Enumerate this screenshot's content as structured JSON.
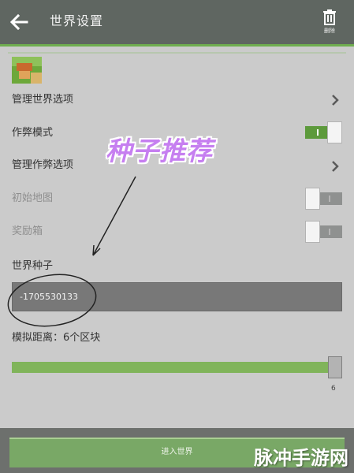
{
  "header": {
    "title": "世界设置",
    "back_icon": "arrow-left-icon",
    "delete_icon": "trash-icon",
    "delete_label": "删除"
  },
  "settings": {
    "manage_world_options": "管理世界选项",
    "cheat_mode": {
      "label": "作弊模式",
      "on": true
    },
    "manage_cheat_options": "管理作弊选项",
    "starting_map": {
      "label": "初始地图",
      "on": false
    },
    "bonus_chest": {
      "label": "奖励箱",
      "on": false
    }
  },
  "seed": {
    "label": "世界种子",
    "value": "-1705530133"
  },
  "view_distance": {
    "label": "模拟距离：6个区块",
    "value": 6,
    "max": 6
  },
  "enter_button": "进入世界",
  "annotation": {
    "text": "种子推荐",
    "color": "#c67ff0"
  },
  "watermark": "脉冲手游网",
  "colors": {
    "accent_green": "#6fae4f",
    "header_bg": "#5f6661"
  }
}
